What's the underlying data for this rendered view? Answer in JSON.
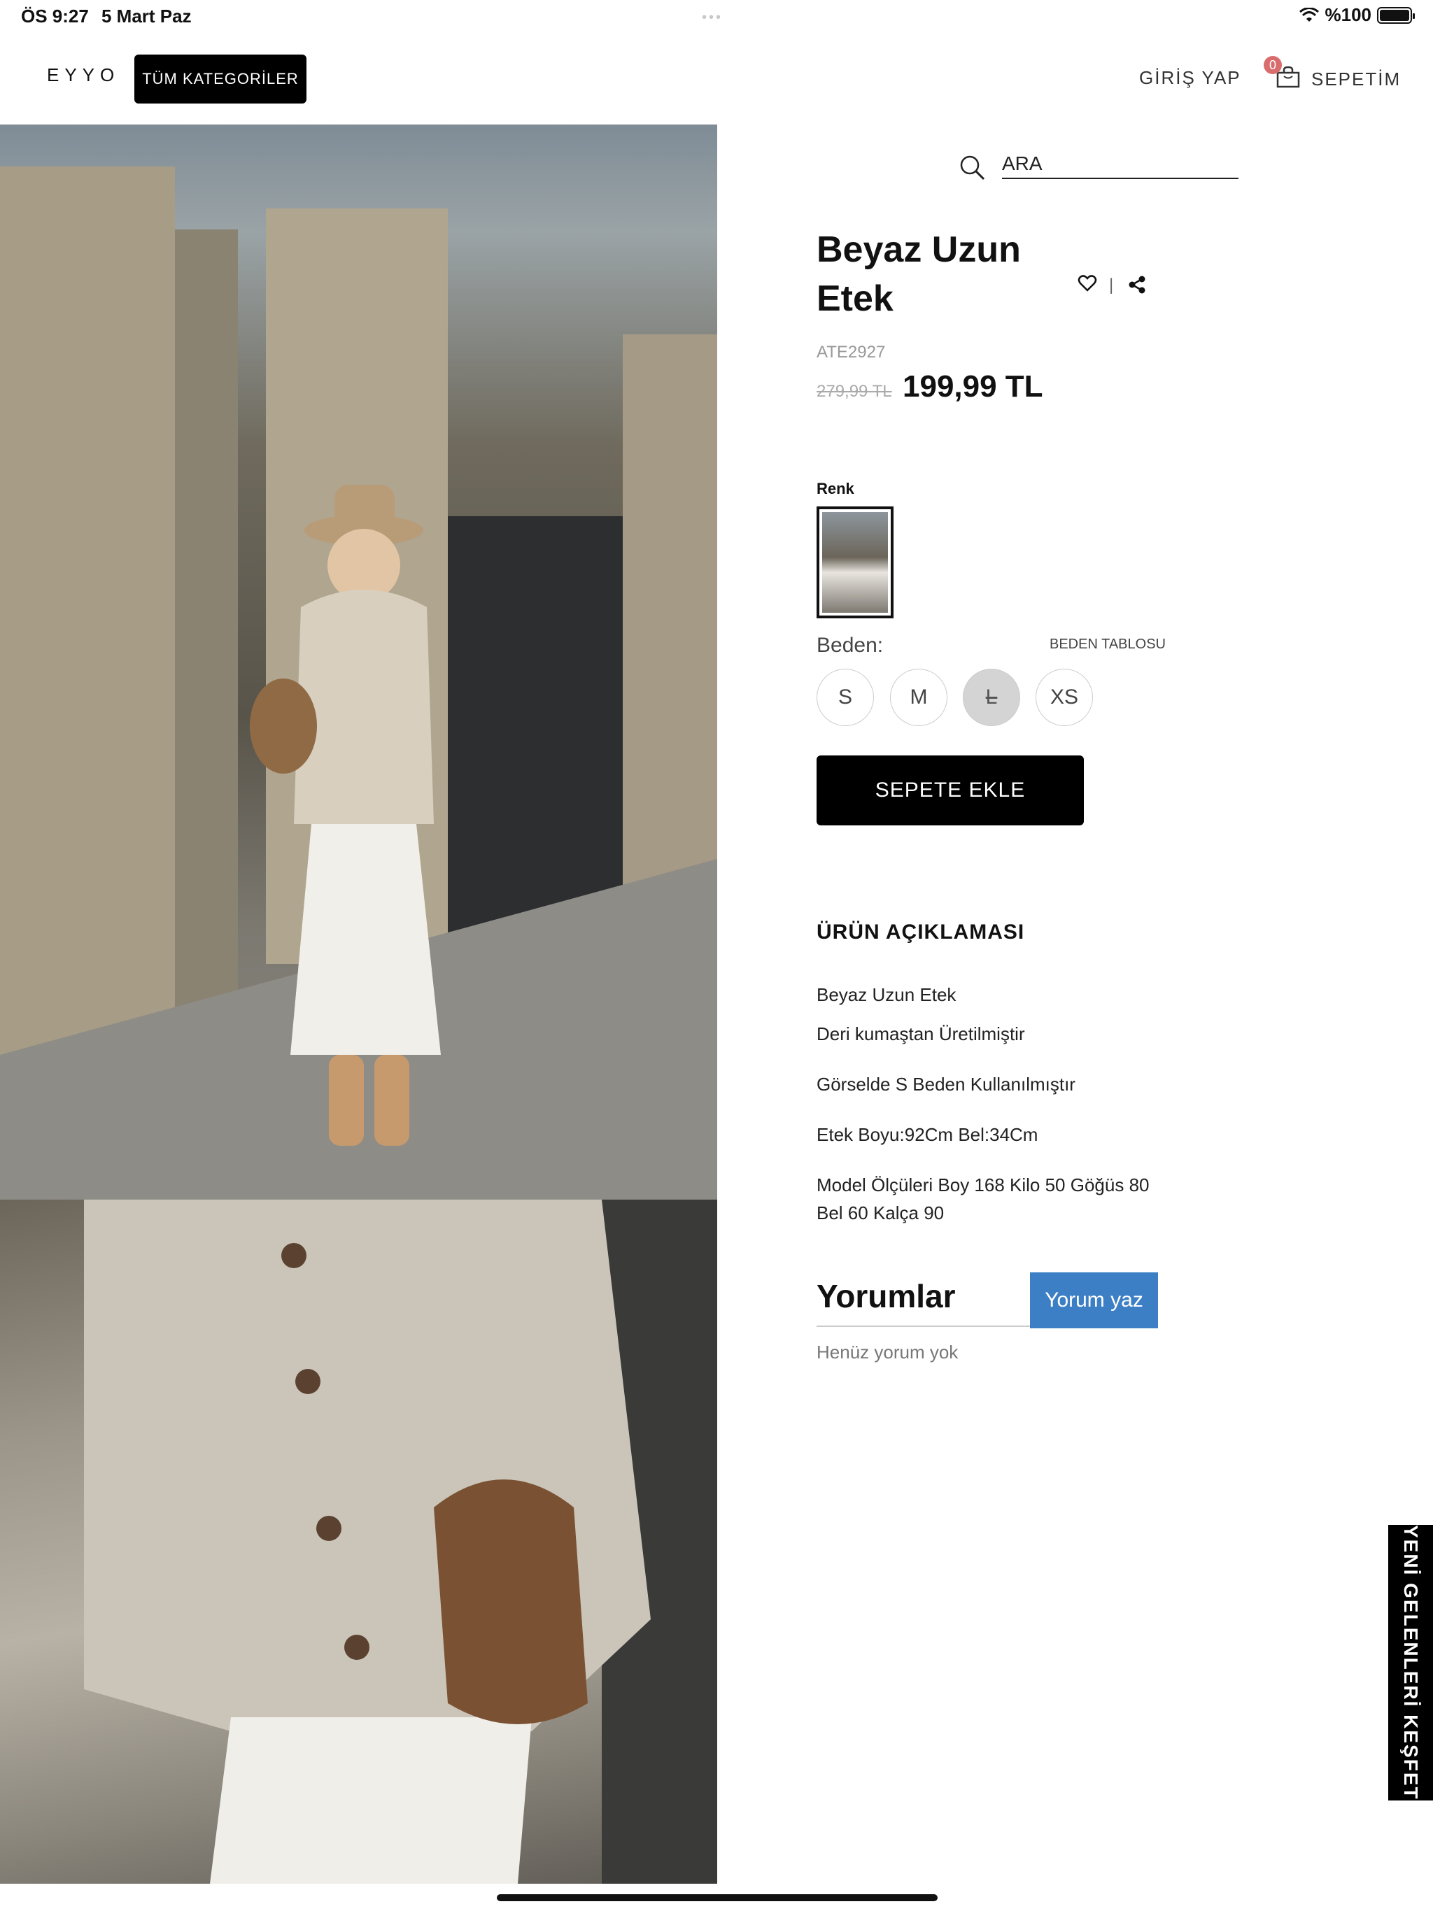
{
  "status_bar": {
    "time": "ÖS 9:27",
    "date": "5 Mart Paz",
    "battery": "%100"
  },
  "header": {
    "logo": "EYYO",
    "categories_button": "TÜM KATEGORİLER",
    "login": "GİRİŞ YAP",
    "cart_label": "SEPETİM",
    "cart_count": "0"
  },
  "search": {
    "placeholder": "ARA"
  },
  "product": {
    "title_line1": "Beyaz Uzun",
    "title_line2": "Etek",
    "sku": "ATE2927",
    "old_price": "279,99 TL",
    "price": "199,99 TL",
    "color_label": "Renk",
    "size_label": "Beden:",
    "size_table": "BEDEN TABLOSU",
    "sizes": [
      "S",
      "M",
      "L",
      "XS"
    ],
    "add_to_cart": "SEPETE EKLE"
  },
  "description": {
    "title": "ÜRÜN AÇIKLAMASI",
    "lines": [
      "Beyaz Uzun Etek",
      "Deri kumaştan Üretilmiştir",
      "Görselde S Beden Kullanılmıştır",
      "Etek Boyu:92Cm Bel:34Cm",
      "Model Ölçüleri Boy 168 Kilo 50 Göğüs 80",
      "Bel 60 Kalça 90"
    ]
  },
  "reviews": {
    "title": "Yorumlar",
    "write_button": "Yorum yaz",
    "empty": "Henüz yorum yok"
  },
  "side_banner": "YENİ GELENLERİ KEŞFET",
  "colors": {
    "accent_blue": "#3d7fc4",
    "badge": "#d96c6c",
    "black": "#000000"
  },
  "icons": [
    "wifi-icon",
    "battery-icon",
    "cart-icon",
    "search-icon",
    "heart-icon",
    "share-icon"
  ]
}
